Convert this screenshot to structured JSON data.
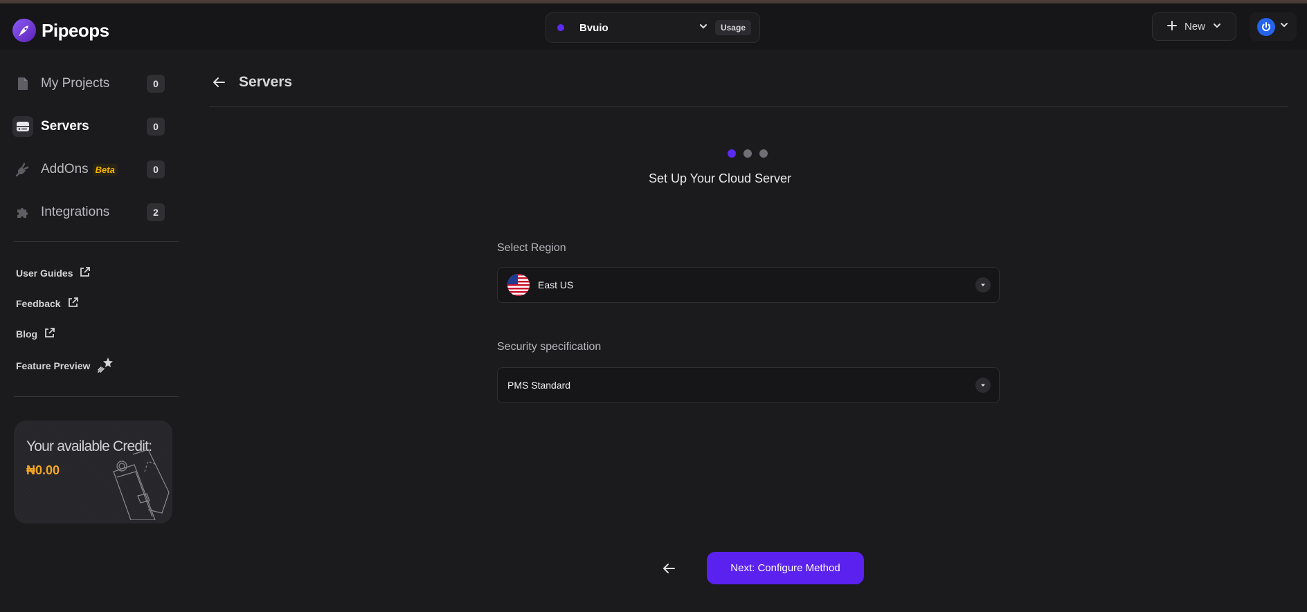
{
  "brand": {
    "name": "Pipeops"
  },
  "project_switcher": {
    "name": "Bvuio",
    "usage_label": "Usage"
  },
  "header_actions": {
    "new_label": "New"
  },
  "sidebar": {
    "nav": [
      {
        "label": "My Projects",
        "count": "0"
      },
      {
        "label": "Servers",
        "count": "0"
      },
      {
        "label": "AddOns",
        "badge": "Beta",
        "count": "0"
      },
      {
        "label": "Integrations",
        "count": "2"
      }
    ],
    "links": [
      {
        "label": "User Guides"
      },
      {
        "label": "Feedback"
      },
      {
        "label": "Blog"
      },
      {
        "label": "Feature Preview"
      }
    ],
    "credit": {
      "title": "Your available Credit:",
      "value": "₦0.00"
    }
  },
  "main": {
    "title": "Servers",
    "setup_title": "Set Up Your Cloud Server",
    "steps": {
      "total": 3,
      "current": 1
    },
    "region": {
      "label": "Select Region",
      "value": "East US"
    },
    "security": {
      "label": "Security specification",
      "value": "PMS Standard"
    },
    "next_label": "Next: Configure Method"
  },
  "colors": {
    "accent": "#5b21ee",
    "credit": "#f5a623",
    "beta": "#f5b400"
  }
}
